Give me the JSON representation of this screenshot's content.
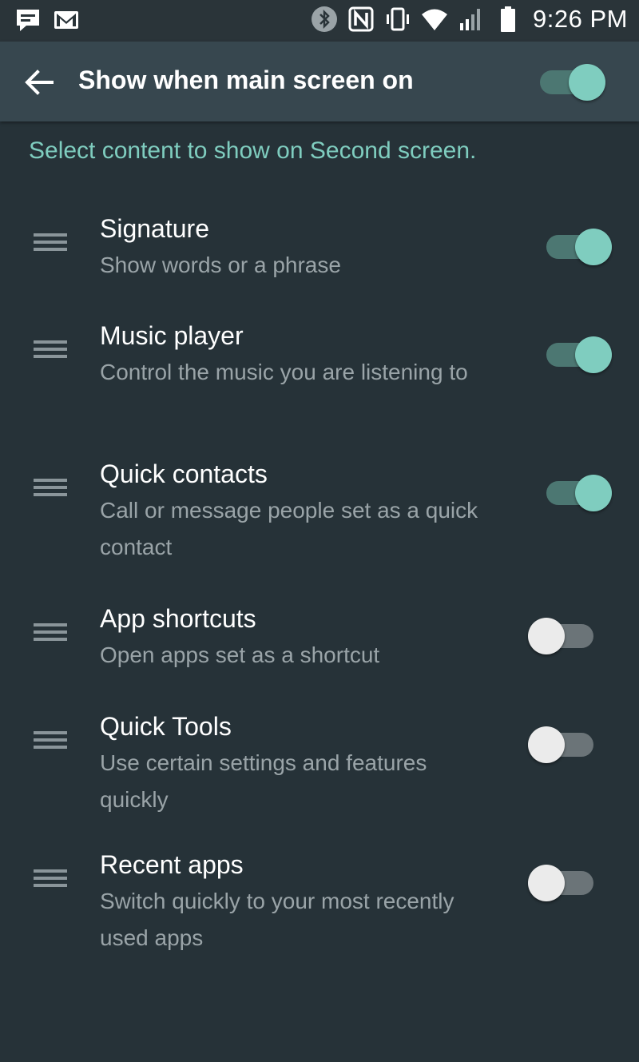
{
  "status_bar": {
    "time": "9:26 PM",
    "icons_left": [
      "message-icon",
      "gmail-icon"
    ],
    "icons_right": [
      "bluetooth-icon",
      "nfc-icon",
      "vibrate-icon",
      "wifi-icon",
      "signal-icon",
      "battery-icon"
    ]
  },
  "app_bar": {
    "title": "Show when main screen on",
    "master_switch_on": true
  },
  "subheader": "Select content to show on Second screen.",
  "items": [
    {
      "title": "Signature",
      "subtitle": "Show words or a phrase",
      "enabled": true
    },
    {
      "title": "Music player",
      "subtitle": "Control the music you are listening to",
      "enabled": true
    },
    {
      "title": "Quick contacts",
      "subtitle": "Call or message people set as a quick contact",
      "enabled": true
    },
    {
      "title": "App shortcuts",
      "subtitle": "Open apps set as a shortcut",
      "enabled": false
    },
    {
      "title": "Quick Tools",
      "subtitle": "Use certain settings and features quickly",
      "enabled": false
    },
    {
      "title": "Recent apps",
      "subtitle": "Switch quickly to your most recently used apps",
      "enabled": false
    }
  ],
  "colors": {
    "background": "#263238",
    "app_bar": "#37474f",
    "accent": "#7fcdbf",
    "switch_on_track": "#4c7772",
    "switch_off_thumb": "#ebebeb"
  }
}
